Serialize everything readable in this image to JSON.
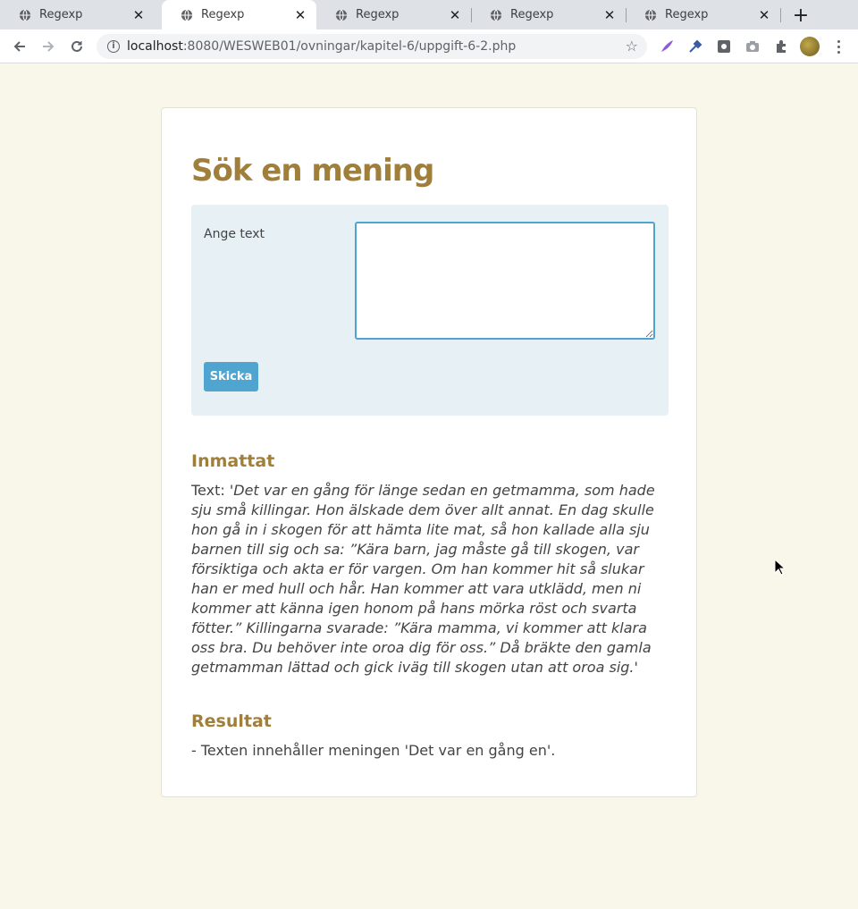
{
  "browser": {
    "tabs": [
      {
        "title": "Regexp",
        "active": false
      },
      {
        "title": "Regexp",
        "active": true
      },
      {
        "title": "Regexp",
        "active": false
      },
      {
        "title": "Regexp",
        "active": false
      },
      {
        "title": "Regexp",
        "active": false
      }
    ],
    "url_host": "localhost",
    "url_path": ":8080/WESWEB01/ovningar/kapitel-6/uppgift-6-2.php"
  },
  "page": {
    "title": "Sök en mening",
    "form": {
      "label": "Ange text",
      "textarea_value": "",
      "submit_label": "Skicka"
    },
    "input_section": {
      "heading": "Inmattat",
      "prefix": "Text:",
      "text": "'Det var en gång för länge sedan en getmamma, som hade sju små killingar. Hon älskade dem över allt annat. En dag skulle hon gå in i skogen för att hämta lite mat, så hon kallade alla sju barnen till sig och sa: ”Kära barn, jag måste gå till skogen, var försiktiga och akta er för vargen. Om han kommer hit så slukar han er med hull och hår. Han kommer att vara utklädd, men ni kommer att känna igen honom på hans mörka röst och svarta fötter.” Killingarna svarade: ”Kära mamma, vi kommer att klara oss bra. Du behöver inte oroa dig för oss.” Då bräkte den gamla getmamman lättad och gick iväg till skogen utan att oroa sig.'"
    },
    "result_section": {
      "heading": "Resultat",
      "text": "- Texten innehåller meningen 'Det var en gång en'."
    }
  },
  "colors": {
    "page_bg": "#f9f6ea",
    "heading": "#a07f3a",
    "form_bg": "#e6f0f5",
    "accent": "#4fa5cf"
  }
}
